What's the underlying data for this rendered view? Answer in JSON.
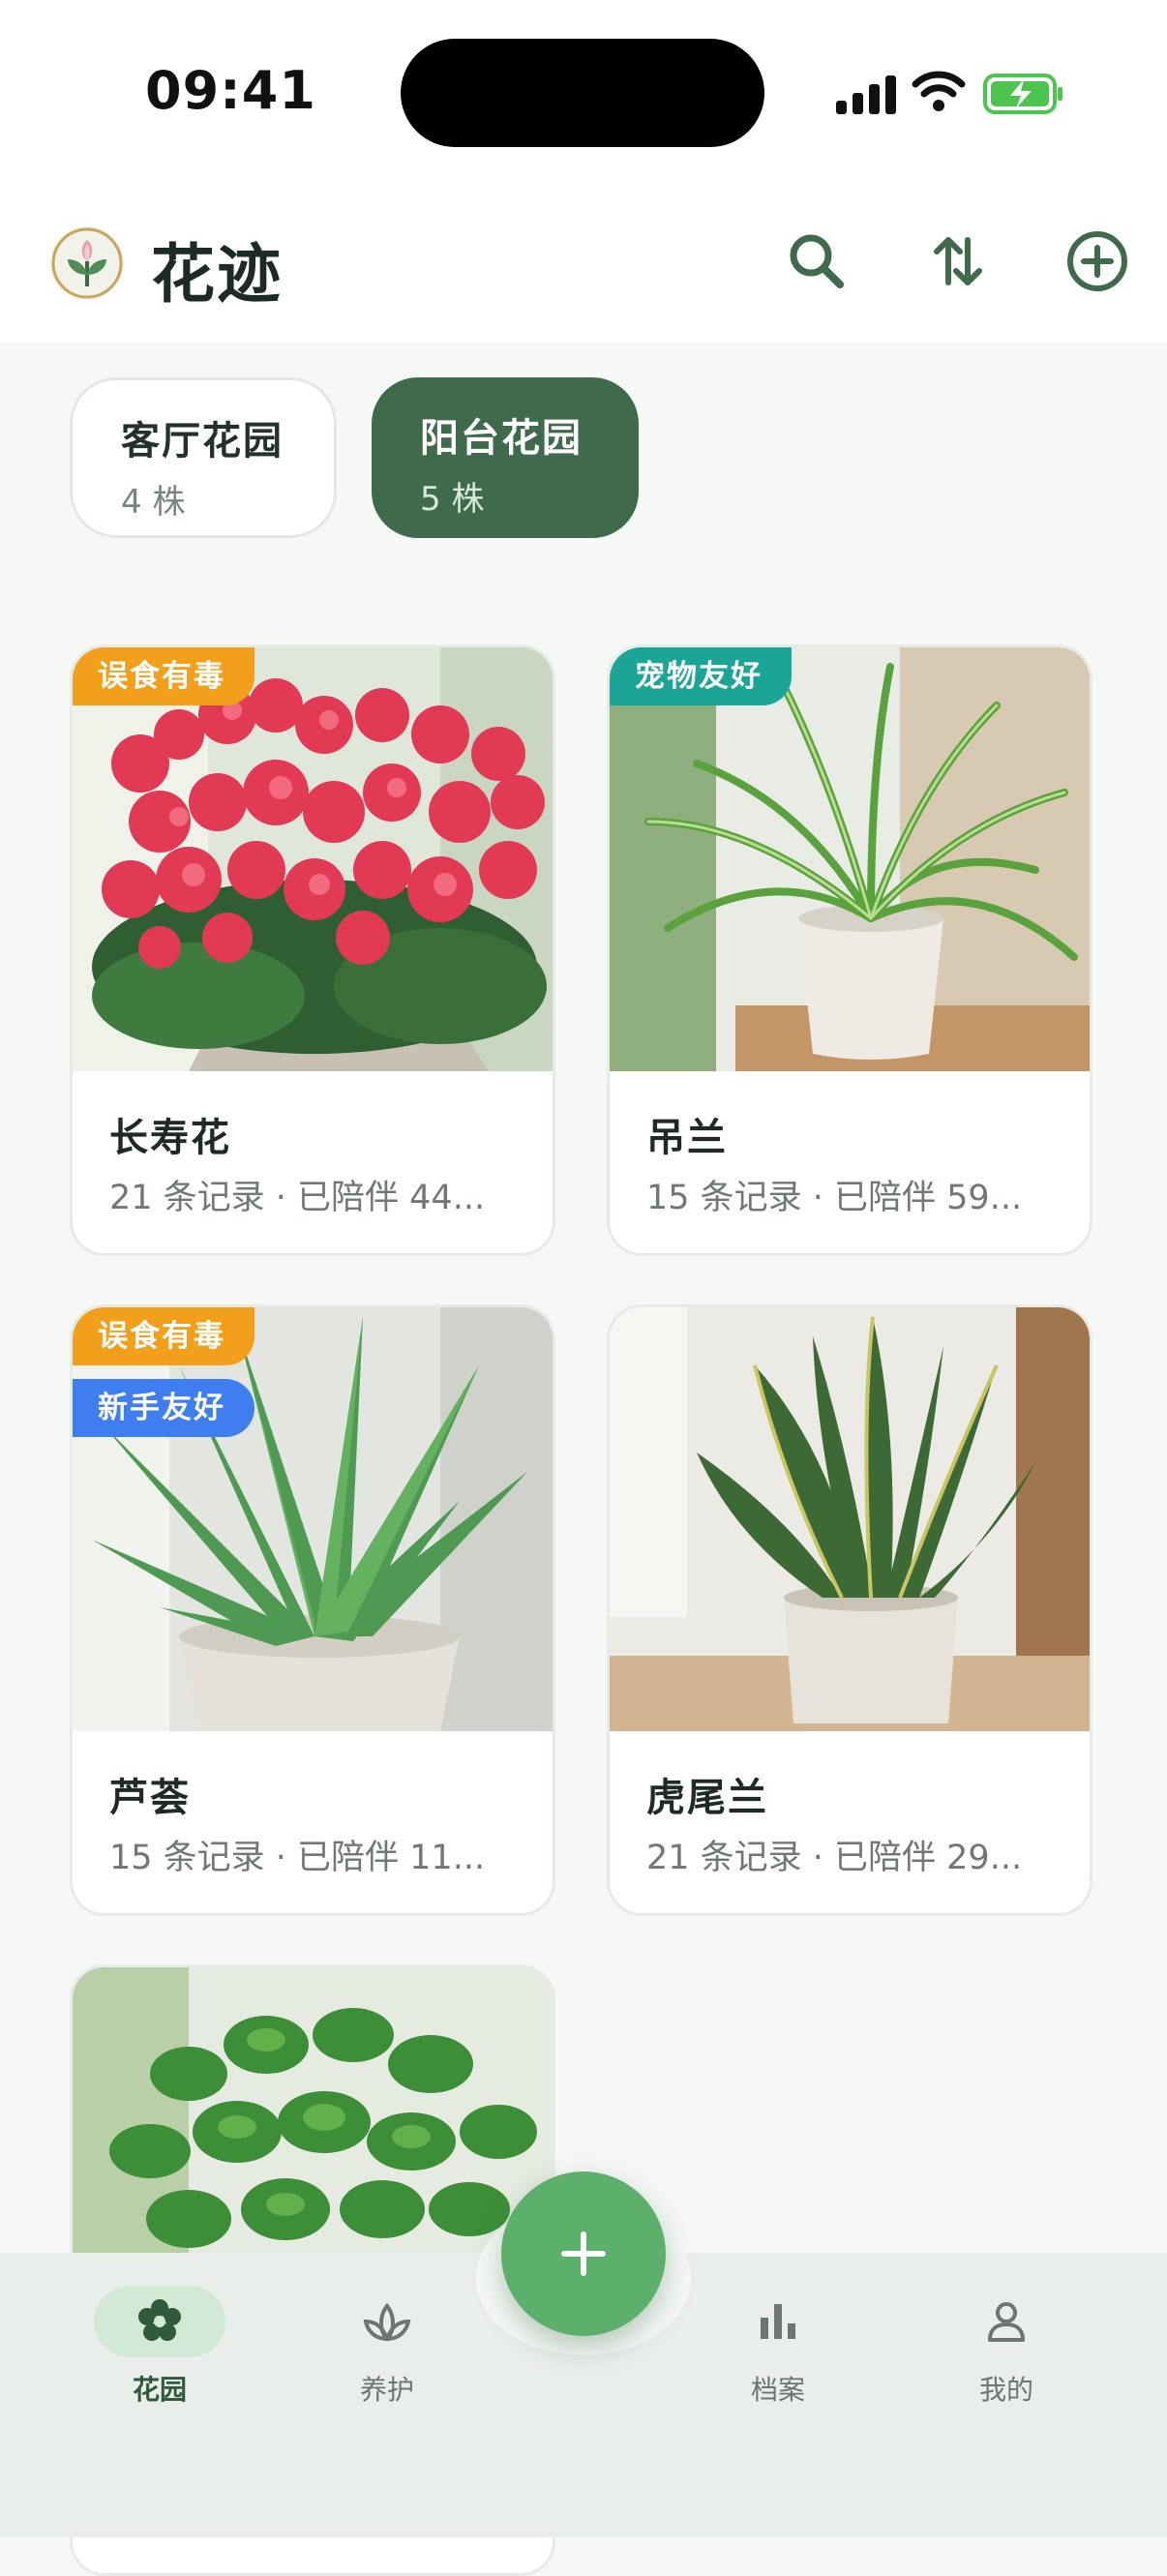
{
  "status_bar": {
    "time": "09:41"
  },
  "header": {
    "title": "花迹"
  },
  "gardens": [
    {
      "name": "客厅花园",
      "count": "4 株",
      "active": false
    },
    {
      "name": "阳台花园",
      "count": "5 株",
      "active": true
    }
  ],
  "plants": [
    {
      "name": "长寿花",
      "meta": "21 条记录  ·  已陪伴 44...",
      "tags": [
        "误食有毒"
      ],
      "image": "kalanchoe"
    },
    {
      "name": "吊兰",
      "meta": "15 条记录  ·  已陪伴 59...",
      "tags": [
        "宠物友好"
      ],
      "image": "spider-plant"
    },
    {
      "name": "芦荟",
      "meta": "15 条记录  ·  已陪伴 11...",
      "tags": [
        "误食有毒",
        "新手友好"
      ],
      "image": "aloe"
    },
    {
      "name": "虎尾兰",
      "meta": "21 条记录  ·  已陪伴 29...",
      "tags": [],
      "image": "snake-plant"
    },
    {
      "name": "",
      "meta": "",
      "tags": [],
      "image": "pothos"
    }
  ],
  "bottom_nav": {
    "items": [
      {
        "label": "花园",
        "icon": "flower-icon",
        "active": true
      },
      {
        "label": "养护",
        "icon": "sprout-icon",
        "active": false
      },
      {
        "label": "档案",
        "icon": "bar-chart-icon",
        "active": false
      },
      {
        "label": "我的",
        "icon": "person-icon",
        "active": false
      }
    ]
  },
  "fab": {
    "icon": "plus-icon"
  },
  "colors": {
    "primary": "#3f6b4c",
    "fab": "#5daf6c",
    "toxic": "#f2a01b",
    "pet_friendly": "#1aa596",
    "beginner": "#3f7ef0",
    "battery": "#4cc44f"
  }
}
